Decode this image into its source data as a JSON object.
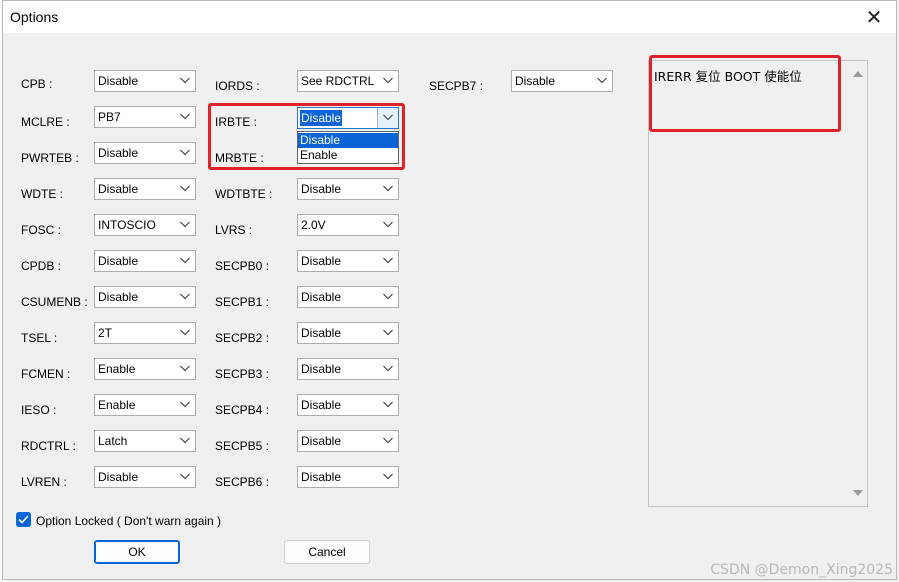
{
  "window": {
    "title": "Options",
    "close_glyph": "✕"
  },
  "fields": {
    "CPB": {
      "label": "CPB :",
      "value": "Disable"
    },
    "MCLRE": {
      "label": "MCLRE :",
      "value": "PB7"
    },
    "PWRTEB": {
      "label": "PWRTEB :",
      "value": "Disable"
    },
    "WDTE": {
      "label": "WDTE :",
      "value": "Disable"
    },
    "FOSC": {
      "label": "FOSC :",
      "value": "INTOSCIO"
    },
    "CPDB": {
      "label": "CPDB :",
      "value": "Disable"
    },
    "CSUMENB": {
      "label": "CSUMENB :",
      "value": "Disable"
    },
    "TSEL": {
      "label": "TSEL :",
      "value": "2T"
    },
    "FCMEN": {
      "label": "FCMEN :",
      "value": "Enable"
    },
    "IESO": {
      "label": "IESO :",
      "value": "Enable"
    },
    "RDCTRL": {
      "label": "RDCTRL :",
      "value": "Latch"
    },
    "LVREN": {
      "label": "LVREN :",
      "value": "Disable"
    },
    "IORDS": {
      "label": "IORDS :",
      "value": "See RDCTRL"
    },
    "IRBTE": {
      "label": "IRBTE :",
      "value": "Disable"
    },
    "MRBTE": {
      "label": "MRBTE :",
      "value": ""
    },
    "WDTBTE": {
      "label": "WDTBTE :",
      "value": "Disable"
    },
    "LVRS": {
      "label": "LVRS :",
      "value": "2.0V"
    },
    "SECPB0": {
      "label": "SECPB0 :",
      "value": "Disable"
    },
    "SECPB1": {
      "label": "SECPB1 :",
      "value": "Disable"
    },
    "SECPB2": {
      "label": "SECPB2 :",
      "value": "Disable"
    },
    "SECPB3": {
      "label": "SECPB3 :",
      "value": "Disable"
    },
    "SECPB4": {
      "label": "SECPB4 :",
      "value": "Disable"
    },
    "SECPB5": {
      "label": "SECPB5 :",
      "value": "Disable"
    },
    "SECPB6": {
      "label": "SECPB6 :",
      "value": "Disable"
    },
    "SECPB7": {
      "label": "SECPB7 :",
      "value": "Disable"
    }
  },
  "open_dropdown": {
    "for": "IRBTE",
    "options": [
      "Disable",
      "Enable"
    ],
    "highlighted": "Disable"
  },
  "description": "IRERR 复位 BOOT 使能位",
  "option_locked": {
    "label": "Option Locked ( Don't warn again )",
    "checked": true
  },
  "buttons": {
    "ok": "OK",
    "cancel": "Cancel"
  },
  "watermark": "CSDN @Demon_Xing2025",
  "colors": {
    "highlight": "#0a64d6",
    "annotation_red": "#e0232a"
  }
}
